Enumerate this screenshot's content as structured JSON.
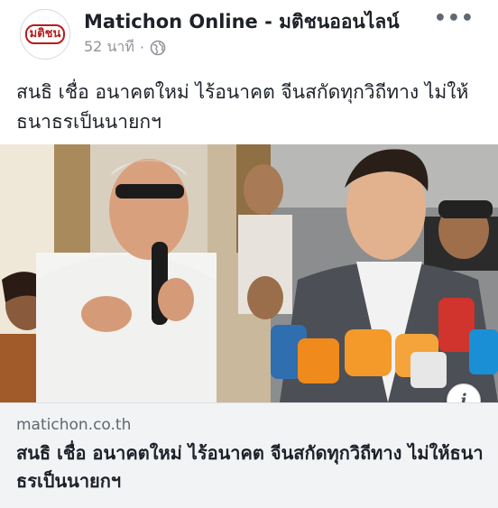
{
  "header": {
    "page_name": "Matichon Online - มติชนออนไลน์",
    "logo_text": "มติชน",
    "timestamp": "52 นาที",
    "separator": "·",
    "privacy_icon": "globe-icon",
    "more_icon": "more-options-icon",
    "more_label": "•••"
  },
  "post": {
    "text": "สนธิ เชื่อ อนาคตใหม่ ไร้อนาคต จีนสกัดทุกวิถีทาง ไม่ให้ธนาธรเป็นนายกฯ"
  },
  "image": {
    "info_icon": "info-icon",
    "info_label": "i"
  },
  "link": {
    "domain": "matichon.co.th",
    "title": "สนธิ เชื่อ อนาคตใหม่ ไร้อนาคต จีนสกัดทุกวิถีทาง ไม่ให้ธนาธรเป็นนายกฯ"
  },
  "colors": {
    "name_text": "#1d2129",
    "meta_text": "#90949c",
    "link_bg": "#f2f3f5",
    "logo_red": "#b71c1c"
  }
}
